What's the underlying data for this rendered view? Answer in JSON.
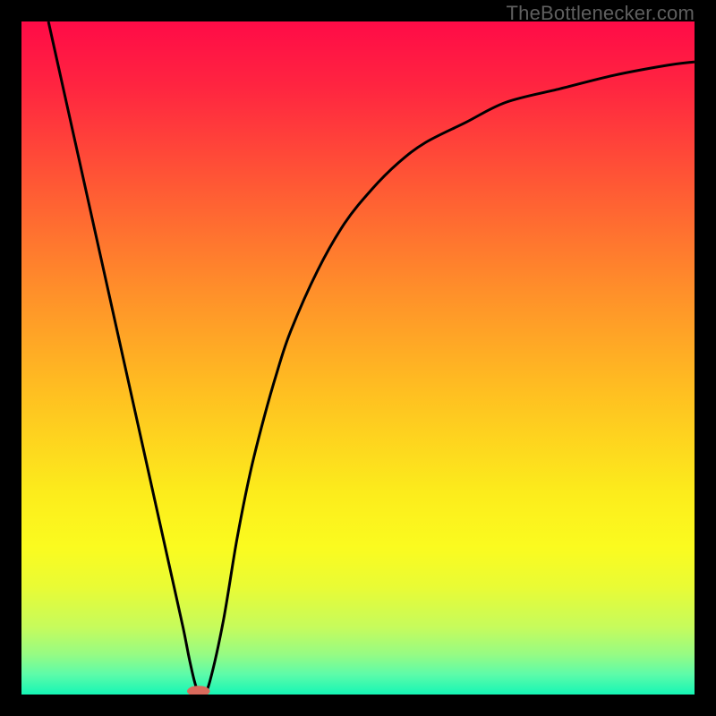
{
  "watermark": "TheBottlenecker.com",
  "chart_data": {
    "type": "line",
    "title": "",
    "xlabel": "",
    "ylabel": "",
    "xlim": [
      0,
      100
    ],
    "ylim": [
      0,
      100
    ],
    "grid": false,
    "legend": false,
    "gradient_stops": [
      {
        "offset": 0.0,
        "color": "#ff0b47"
      },
      {
        "offset": 0.1,
        "color": "#ff2640"
      },
      {
        "offset": 0.25,
        "color": "#ff5b34"
      },
      {
        "offset": 0.4,
        "color": "#ff8f2a"
      },
      {
        "offset": 0.55,
        "color": "#ffbf21"
      },
      {
        "offset": 0.7,
        "color": "#fcec1c"
      },
      {
        "offset": 0.78,
        "color": "#fbfb1f"
      },
      {
        "offset": 0.84,
        "color": "#e9fb35"
      },
      {
        "offset": 0.9,
        "color": "#c6fb5c"
      },
      {
        "offset": 0.94,
        "color": "#97fb83"
      },
      {
        "offset": 0.97,
        "color": "#5dfba9"
      },
      {
        "offset": 1.0,
        "color": "#15f6b5"
      }
    ],
    "series": [
      {
        "name": "curve",
        "color": "#000000",
        "x": [
          4,
          6,
          8,
          10,
          12,
          14,
          16,
          18,
          20,
          22,
          24,
          25,
          26,
          27,
          28,
          30,
          32,
          34,
          36,
          38,
          40,
          44,
          48,
          52,
          56,
          60,
          66,
          72,
          80,
          88,
          96,
          100
        ],
        "y": [
          100,
          91,
          82,
          73,
          64,
          55,
          46,
          37,
          28,
          19,
          10,
          5,
          1,
          0,
          2,
          11,
          23,
          33,
          41,
          48,
          54,
          63,
          70,
          75,
          79,
          82,
          85,
          88,
          90,
          92,
          93.5,
          94
        ]
      }
    ],
    "marker": {
      "name": "notch-marker",
      "x": 26.3,
      "y": 0.5,
      "rx": 1.7,
      "ry": 0.8,
      "fill": "#d96a5c"
    }
  }
}
